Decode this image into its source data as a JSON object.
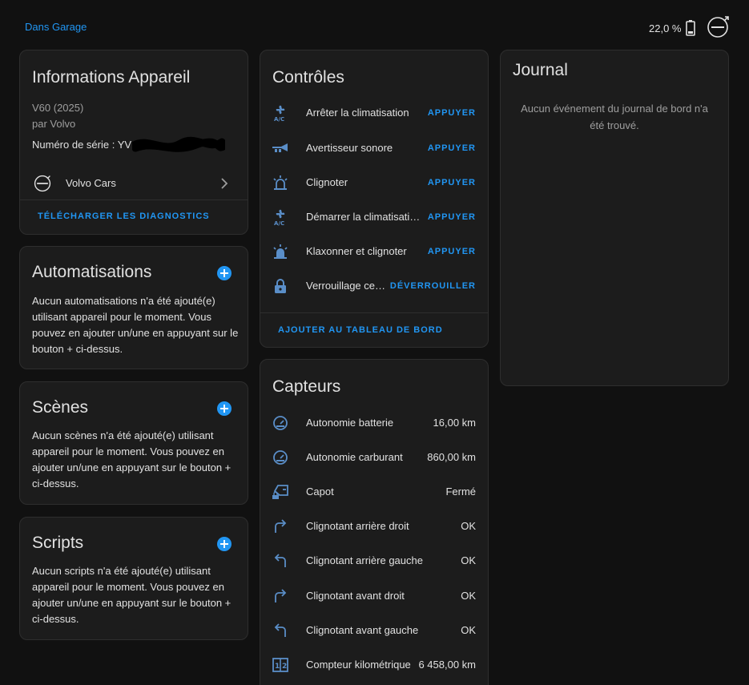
{
  "topbar": {
    "area_link": "Dans Garage",
    "battery_level": "22,0 %",
    "brand_logo": "volvo-logo-icon"
  },
  "device_info": {
    "title": "Informations Appareil",
    "model": "V60 (2025)",
    "manufacturer": "par Volvo",
    "serial_label": "Numéro de série : YV1",
    "integration_label": "Volvo Cars",
    "download_label": "TÉLÉCHARGER LES DIAGNOSTICS"
  },
  "automations": {
    "title": "Automatisations",
    "text": "Aucun automatisations n'a été ajouté(e) utilisant appareil pour le moment. Vous pouvez en ajouter un/une en appuyant sur le bouton + ci-dessus."
  },
  "scenes": {
    "title": "Scènes",
    "text": "Aucun scènes n'a été ajouté(e) utilisant appareil pour le moment. Vous pouvez en ajouter un/une en appuyant sur le bouton + ci-dessus."
  },
  "scripts": {
    "title": "Scripts",
    "text": "Aucun scripts n'a été ajouté(e) utilisant appareil pour le moment. Vous pouvez en ajouter un/une en appuyant sur le bouton + ci-dessus."
  },
  "controls": {
    "title": "Contrôles",
    "items": [
      {
        "label": "Arrêter la climatisation",
        "action": "APPUYER",
        "icon": "fan-ac-icon"
      },
      {
        "label": "Avertisseur sonore",
        "action": "APPUYER",
        "icon": "bugle-horn-icon"
      },
      {
        "label": "Clignoter",
        "action": "APPUYER",
        "icon": "alarm-light-outline-icon"
      },
      {
        "label": "Démarrer la climatisati…",
        "action": "APPUYER",
        "icon": "fan-ac-icon"
      },
      {
        "label": "Klaxonner et clignoter",
        "action": "APPUYER",
        "icon": "alarm-light-icon"
      },
      {
        "label": "Verrouillage cen…",
        "action": "DÉVERROUILLER",
        "icon": "lock-icon"
      }
    ],
    "add_to_dashboard": "AJOUTER AU TABLEAU DE BORD"
  },
  "sensors": {
    "title": "Capteurs",
    "items": [
      {
        "label": "Autonomie batterie",
        "value": "16,00 km",
        "icon": "gauge-icon"
      },
      {
        "label": "Autonomie carburant",
        "value": "860,00 km",
        "icon": "gauge-icon"
      },
      {
        "label": "Capot",
        "value": "Fermé",
        "icon": "car-door-lock-icon"
      },
      {
        "label": "Clignotant arrière droit",
        "value": "OK",
        "icon": "arrow-turn-right-icon"
      },
      {
        "label": "Clignotant arrière gauche",
        "value": "OK",
        "icon": "arrow-turn-left-icon"
      },
      {
        "label": "Clignotant avant droit",
        "value": "OK",
        "icon": "arrow-turn-right-icon"
      },
      {
        "label": "Clignotant avant gauche",
        "value": "OK",
        "icon": "arrow-turn-left-icon"
      },
      {
        "label": "Compteur kilométrique",
        "value": "6 458,00 km",
        "icon": "counter-icon"
      }
    ]
  },
  "logbook": {
    "title": "Journal",
    "empty_text": "Aucun événement du journal de bord n'a été trouvé."
  },
  "colors": {
    "accent": "#2196f3",
    "icon": "#5a8ec8",
    "background": "#111111",
    "card": "#1c1c1c"
  }
}
